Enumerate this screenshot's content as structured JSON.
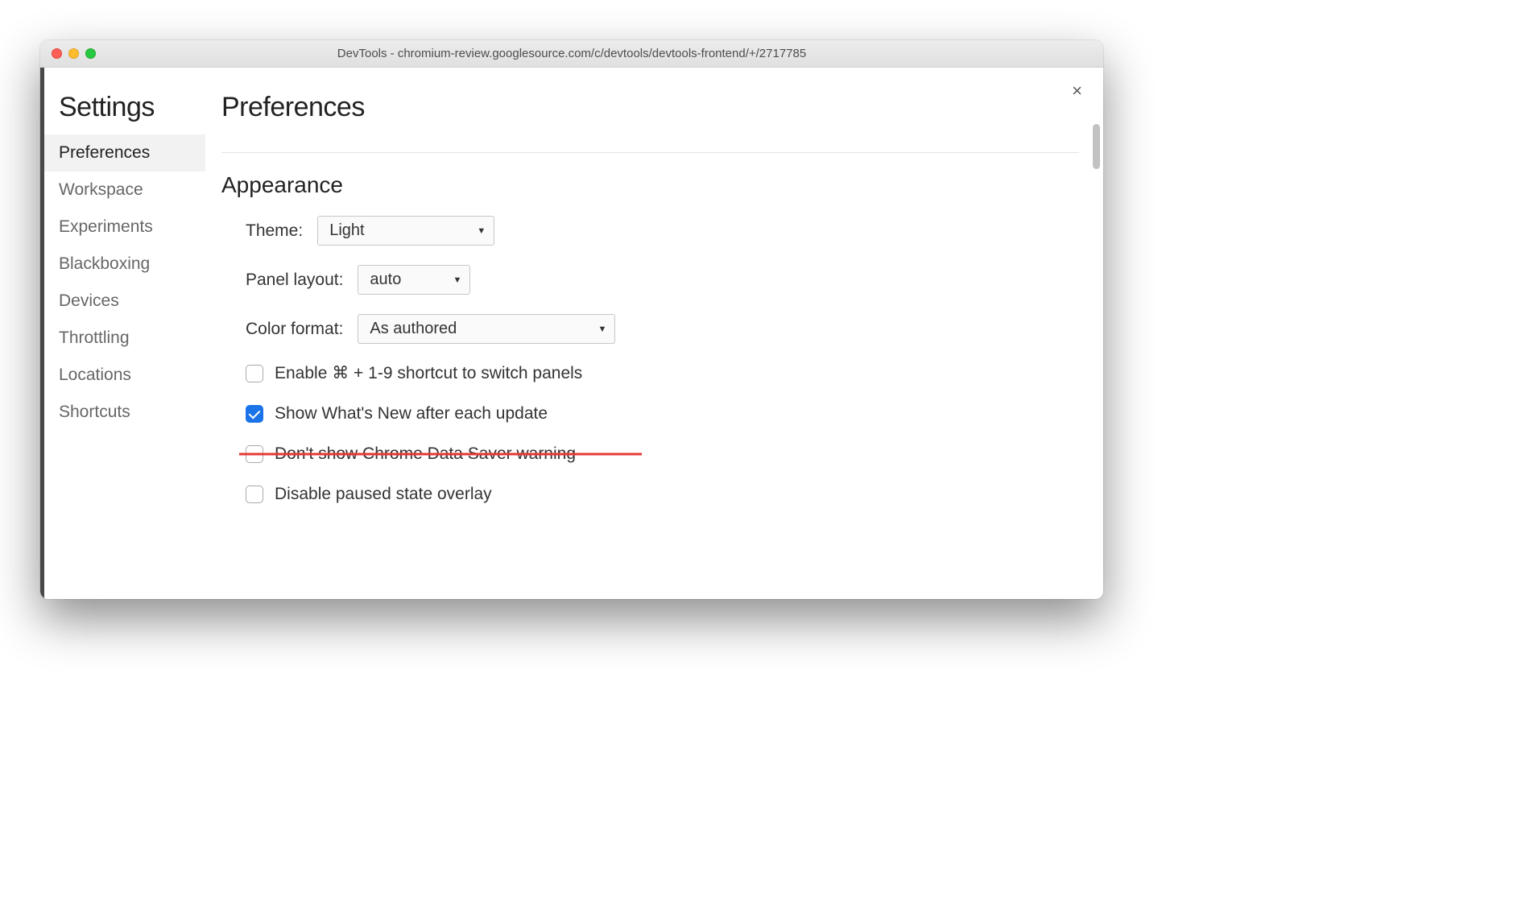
{
  "window": {
    "title": "DevTools - chromium-review.googlesource.com/c/devtools/devtools-frontend/+/2717785"
  },
  "close_label": "×",
  "sidebar": {
    "heading": "Settings",
    "items": [
      {
        "label": "Preferences",
        "active": true
      },
      {
        "label": "Workspace",
        "active": false
      },
      {
        "label": "Experiments",
        "active": false
      },
      {
        "label": "Blackboxing",
        "active": false
      },
      {
        "label": "Devices",
        "active": false
      },
      {
        "label": "Throttling",
        "active": false
      },
      {
        "label": "Locations",
        "active": false
      },
      {
        "label": "Shortcuts",
        "active": false
      }
    ]
  },
  "main": {
    "heading": "Preferences",
    "section_heading": "Appearance",
    "theme": {
      "label": "Theme:",
      "value": "Light"
    },
    "panel_layout": {
      "label": "Panel layout:",
      "value": "auto"
    },
    "color_format": {
      "label": "Color format:",
      "value": "As authored"
    },
    "checkboxes": [
      {
        "label": "Enable ⌘ + 1-9 shortcut to switch panels",
        "checked": false,
        "struck": false
      },
      {
        "label": "Show What's New after each update",
        "checked": true,
        "struck": false
      },
      {
        "label": "Don't show Chrome Data Saver warning",
        "checked": false,
        "struck": true
      },
      {
        "label": "Disable paused state overlay",
        "checked": false,
        "struck": false
      }
    ]
  }
}
